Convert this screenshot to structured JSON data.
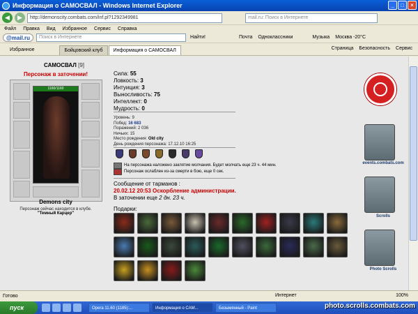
{
  "window": {
    "title": "Информация о САМОСВАЛ - Windows Internet Explorer"
  },
  "address": {
    "url": "http://demonscity.combats.com/inf.pl?1292349981",
    "search_placeholder": "mail.ru: Поиск в Интернете"
  },
  "menu": [
    "Файл",
    "Правка",
    "Вид",
    "Избранное",
    "Сервис",
    "Справка"
  ],
  "mailru": {
    "logo": "@mail.ru",
    "search_placeholder": "Поиск в Интернете",
    "find_label": "Найти!",
    "mail_label": "Почта",
    "ok_label": "Одноклассники",
    "music_label": "Музыка",
    "weather_label": "Москва -20°C"
  },
  "tabs": {
    "favorites_label": "Избранное",
    "items": [
      {
        "label": "Бойцовский клуб"
      },
      {
        "label": "Информация о САМОСВАЛ"
      }
    ],
    "tools": [
      "Страница",
      "Безопасность",
      "Сервис"
    ]
  },
  "character": {
    "name": "САМОСВАЛ",
    "level": "[9]",
    "jail_title": "Персонаж в заточении!",
    "hp": "1160/1160",
    "city": "Demons city",
    "location_note": "Персонаж сейчас находится в клубе.",
    "room": "\"Темный Карцер\""
  },
  "stats": [
    {
      "label": "Сила:",
      "value": "55"
    },
    {
      "label": "Ловкость:",
      "value": "3"
    },
    {
      "label": "Интуиция:",
      "value": "3"
    },
    {
      "label": "Выносливость:",
      "value": "75"
    },
    {
      "label": "Интеллект:",
      "value": "0"
    },
    {
      "label": "Мудрость:",
      "value": "0"
    }
  ],
  "info": {
    "level_label": "Уровень:",
    "level_value": "9",
    "wins_label": "Побед:",
    "wins_value": "16 683",
    "losses_label": "Поражений:",
    "losses_value": "2 036",
    "draws_label": "Ничьих:",
    "draws_value": "15",
    "birthplace_label": "Место рождения:",
    "birthplace_value": "Old city",
    "birthday_label": "День рождения персонажа:",
    "birthday_value": "17.12.10 16:25"
  },
  "effects": [
    "На персонажа наложено заклятие молчания. Будет молчать еще 23 ч. 44 мин.",
    "Персонаж ослаблен из-за смерти в бою, еще 0 сек."
  ],
  "message": {
    "header": "Сообщение от тарманов :",
    "text": "20.02.12 20:53 Оскорбление администрации.",
    "prison_prefix": "В заточении еще",
    "prison_time": "2 дн. 23 ч."
  },
  "gifts_label": "Подарки:",
  "gifts": [
    {
      "color": "#8a2a1a"
    },
    {
      "color": "#4a6a3a"
    },
    {
      "color": "#7a5a3a"
    },
    {
      "color": "#c8c0b0"
    },
    {
      "color": "#6a2a2a"
    },
    {
      "color": "#2a6a2a"
    },
    {
      "color": "#a02020"
    },
    {
      "color": "#3a3a4a"
    },
    {
      "color": "#2a7a7a"
    },
    {
      "color": "#8a6a3a"
    },
    {
      "color": "#4a7ab0"
    },
    {
      "color": "#1a5a1a"
    },
    {
      "color": "#3a4a3a"
    },
    {
      "color": "#2a5a5a"
    },
    {
      "color": "#1a6a2a"
    },
    {
      "color": "#505060"
    },
    {
      "color": "#3a6a3a"
    },
    {
      "color": "#2a2a5a"
    },
    {
      "color": "#4a6a4a"
    },
    {
      "color": "#6a5a3a"
    },
    {
      "color": "#c8a020"
    },
    {
      "color": "#c89020"
    },
    {
      "color": "#8a1a1a"
    },
    {
      "color": "#4a8a3a"
    }
  ],
  "sidebar_links": [
    {
      "label": "events.combats.com"
    },
    {
      "label": "Scrolls"
    },
    {
      "label": "Photo Scrolls"
    }
  ],
  "status": {
    "ready": "Готово",
    "zone": "Интернет",
    "zoom": "100%"
  },
  "taskbar": {
    "start": "пуск",
    "tasks": [
      "Opera 11.60 (1185):...",
      "Информация о САМ...",
      "Безымянный - Paint"
    ]
  },
  "watermark": "photo.scrolls.combats.com"
}
